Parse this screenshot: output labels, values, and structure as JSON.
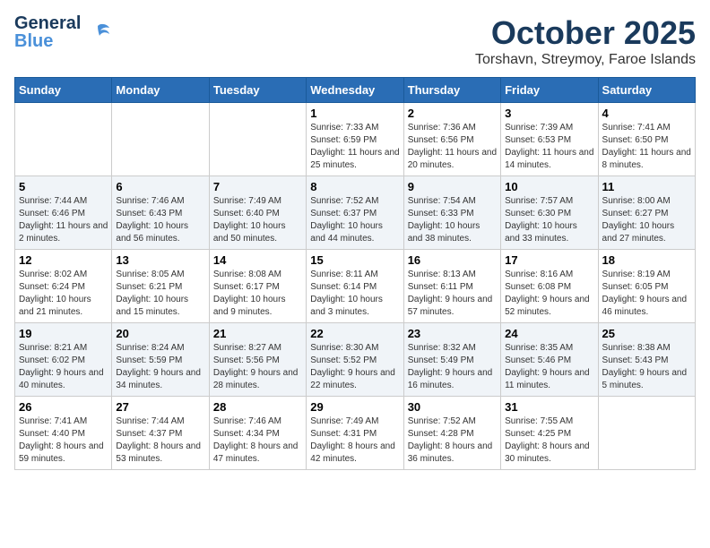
{
  "header": {
    "logo_general": "General",
    "logo_blue": "Blue",
    "month_title": "October 2025",
    "location": "Torshavn, Streymoy, Faroe Islands"
  },
  "days_of_week": [
    "Sunday",
    "Monday",
    "Tuesday",
    "Wednesday",
    "Thursday",
    "Friday",
    "Saturday"
  ],
  "weeks": [
    [
      {
        "day": "",
        "info": ""
      },
      {
        "day": "",
        "info": ""
      },
      {
        "day": "",
        "info": ""
      },
      {
        "day": "1",
        "info": "Sunrise: 7:33 AM\nSunset: 6:59 PM\nDaylight: 11 hours and 25 minutes."
      },
      {
        "day": "2",
        "info": "Sunrise: 7:36 AM\nSunset: 6:56 PM\nDaylight: 11 hours and 20 minutes."
      },
      {
        "day": "3",
        "info": "Sunrise: 7:39 AM\nSunset: 6:53 PM\nDaylight: 11 hours and 14 minutes."
      },
      {
        "day": "4",
        "info": "Sunrise: 7:41 AM\nSunset: 6:50 PM\nDaylight: 11 hours and 8 minutes."
      }
    ],
    [
      {
        "day": "5",
        "info": "Sunrise: 7:44 AM\nSunset: 6:46 PM\nDaylight: 11 hours and 2 minutes."
      },
      {
        "day": "6",
        "info": "Sunrise: 7:46 AM\nSunset: 6:43 PM\nDaylight: 10 hours and 56 minutes."
      },
      {
        "day": "7",
        "info": "Sunrise: 7:49 AM\nSunset: 6:40 PM\nDaylight: 10 hours and 50 minutes."
      },
      {
        "day": "8",
        "info": "Sunrise: 7:52 AM\nSunset: 6:37 PM\nDaylight: 10 hours and 44 minutes."
      },
      {
        "day": "9",
        "info": "Sunrise: 7:54 AM\nSunset: 6:33 PM\nDaylight: 10 hours and 38 minutes."
      },
      {
        "day": "10",
        "info": "Sunrise: 7:57 AM\nSunset: 6:30 PM\nDaylight: 10 hours and 33 minutes."
      },
      {
        "day": "11",
        "info": "Sunrise: 8:00 AM\nSunset: 6:27 PM\nDaylight: 10 hours and 27 minutes."
      }
    ],
    [
      {
        "day": "12",
        "info": "Sunrise: 8:02 AM\nSunset: 6:24 PM\nDaylight: 10 hours and 21 minutes."
      },
      {
        "day": "13",
        "info": "Sunrise: 8:05 AM\nSunset: 6:21 PM\nDaylight: 10 hours and 15 minutes."
      },
      {
        "day": "14",
        "info": "Sunrise: 8:08 AM\nSunset: 6:17 PM\nDaylight: 10 hours and 9 minutes."
      },
      {
        "day": "15",
        "info": "Sunrise: 8:11 AM\nSunset: 6:14 PM\nDaylight: 10 hours and 3 minutes."
      },
      {
        "day": "16",
        "info": "Sunrise: 8:13 AM\nSunset: 6:11 PM\nDaylight: 9 hours and 57 minutes."
      },
      {
        "day": "17",
        "info": "Sunrise: 8:16 AM\nSunset: 6:08 PM\nDaylight: 9 hours and 52 minutes."
      },
      {
        "day": "18",
        "info": "Sunrise: 8:19 AM\nSunset: 6:05 PM\nDaylight: 9 hours and 46 minutes."
      }
    ],
    [
      {
        "day": "19",
        "info": "Sunrise: 8:21 AM\nSunset: 6:02 PM\nDaylight: 9 hours and 40 minutes."
      },
      {
        "day": "20",
        "info": "Sunrise: 8:24 AM\nSunset: 5:59 PM\nDaylight: 9 hours and 34 minutes."
      },
      {
        "day": "21",
        "info": "Sunrise: 8:27 AM\nSunset: 5:56 PM\nDaylight: 9 hours and 28 minutes."
      },
      {
        "day": "22",
        "info": "Sunrise: 8:30 AM\nSunset: 5:52 PM\nDaylight: 9 hours and 22 minutes."
      },
      {
        "day": "23",
        "info": "Sunrise: 8:32 AM\nSunset: 5:49 PM\nDaylight: 9 hours and 16 minutes."
      },
      {
        "day": "24",
        "info": "Sunrise: 8:35 AM\nSunset: 5:46 PM\nDaylight: 9 hours and 11 minutes."
      },
      {
        "day": "25",
        "info": "Sunrise: 8:38 AM\nSunset: 5:43 PM\nDaylight: 9 hours and 5 minutes."
      }
    ],
    [
      {
        "day": "26",
        "info": "Sunrise: 7:41 AM\nSunset: 4:40 PM\nDaylight: 8 hours and 59 minutes."
      },
      {
        "day": "27",
        "info": "Sunrise: 7:44 AM\nSunset: 4:37 PM\nDaylight: 8 hours and 53 minutes."
      },
      {
        "day": "28",
        "info": "Sunrise: 7:46 AM\nSunset: 4:34 PM\nDaylight: 8 hours and 47 minutes."
      },
      {
        "day": "29",
        "info": "Sunrise: 7:49 AM\nSunset: 4:31 PM\nDaylight: 8 hours and 42 minutes."
      },
      {
        "day": "30",
        "info": "Sunrise: 7:52 AM\nSunset: 4:28 PM\nDaylight: 8 hours and 36 minutes."
      },
      {
        "day": "31",
        "info": "Sunrise: 7:55 AM\nSunset: 4:25 PM\nDaylight: 8 hours and 30 minutes."
      },
      {
        "day": "",
        "info": ""
      }
    ]
  ]
}
